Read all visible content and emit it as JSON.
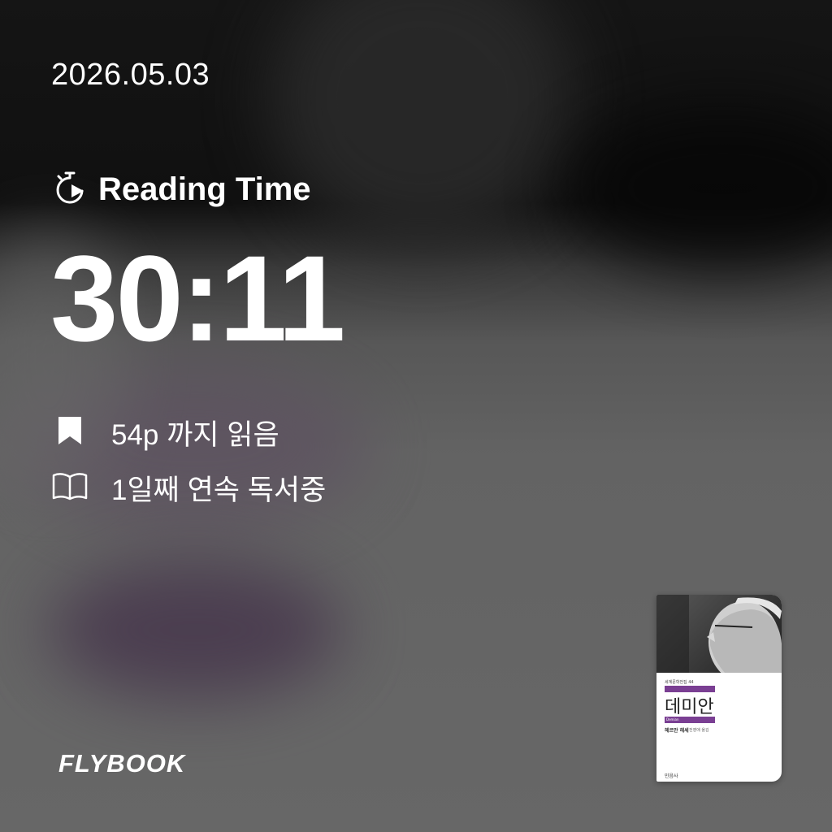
{
  "date": "2026.05.03",
  "reading_label": "Reading Time",
  "timer": "30:11",
  "progress_text": "54p 까지 읽음",
  "streak_text": "1일째 연속 독서중",
  "logo": "FLYBOOK",
  "icons": {
    "timer": "stopwatch-play-icon",
    "progress": "bookmark-icon",
    "streak": "open-book-icon"
  },
  "book_cover": {
    "series": "세계문학전집 44",
    "title": "데미안",
    "subtitle": "Demian",
    "author": "헤르만 헤세",
    "translator": "전영애 옮김",
    "publisher": "민음사",
    "accent": "#7a3f93"
  }
}
